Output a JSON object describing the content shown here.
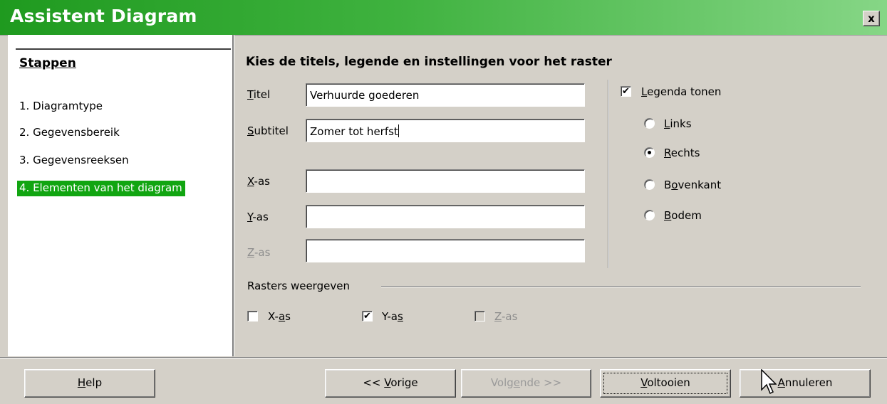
{
  "window": {
    "title": "Assistent Diagram",
    "close_glyph": "x",
    "title_color": "#1f9a1f"
  },
  "steps": {
    "heading": "Stappen",
    "items": [
      {
        "label": "1. Diagramtype",
        "active": false
      },
      {
        "label": "2. Gegevensbereik",
        "active": false
      },
      {
        "label": "3. Gegevensreeksen",
        "active": false
      },
      {
        "label": "4. Elementen van het diagram",
        "active": true
      }
    ],
    "active_color": "#11a511"
  },
  "main": {
    "heading": "Kies de titels, legende en instellingen voor het raster",
    "fields": {
      "titel": {
        "label_u": "T",
        "label_rest": "itel",
        "value": "Verhuurde goederen"
      },
      "subtitel": {
        "label_u": "S",
        "label_rest": "ubtitel",
        "value": "Zomer tot herfst"
      },
      "x_as": {
        "label_u": "X",
        "label_rest": "-as",
        "value": ""
      },
      "y_as": {
        "label_u": "Y",
        "label_rest": "-as",
        "value": ""
      },
      "z_as": {
        "label_u": "Z",
        "label_rest": "-as",
        "value": "",
        "disabled": true
      }
    }
  },
  "legend": {
    "show": {
      "label_u": "L",
      "label_rest": "egenda tonen",
      "checked": true
    },
    "options": [
      {
        "label_u": "L",
        "label_rest": "inks",
        "selected": false
      },
      {
        "label_u": "R",
        "label_rest": "echts",
        "selected": true
      },
      {
        "label_pre": "B",
        "label_u": "o",
        "label_rest": "venkant",
        "selected": false
      },
      {
        "label_u": "B",
        "label_rest": "odem",
        "selected": false
      }
    ]
  },
  "grid": {
    "label": "Rasters weergeven",
    "x": {
      "label_pre": "X-",
      "label_u": "a",
      "label_rest": "s",
      "checked": false
    },
    "y": {
      "label_pre": "Y-a",
      "label_u": "s",
      "label_rest": "",
      "checked": true
    },
    "z": {
      "label_u": "Z",
      "label_rest": "-as",
      "checked": false,
      "disabled": true
    }
  },
  "buttons": {
    "help": {
      "label_u": "H",
      "label_rest": "elp"
    },
    "prev": {
      "label_pre": "<< ",
      "label_u": "V",
      "label_rest": "orige"
    },
    "next": {
      "label_pre": "Volg",
      "label_u": "e",
      "label_rest": "nde >>",
      "disabled": true
    },
    "finish": {
      "label_u": "V",
      "label_rest": "oltooien"
    },
    "cancel": {
      "label_u": "A",
      "label_rest": "nnuleren"
    }
  },
  "check_glyph": "✔"
}
